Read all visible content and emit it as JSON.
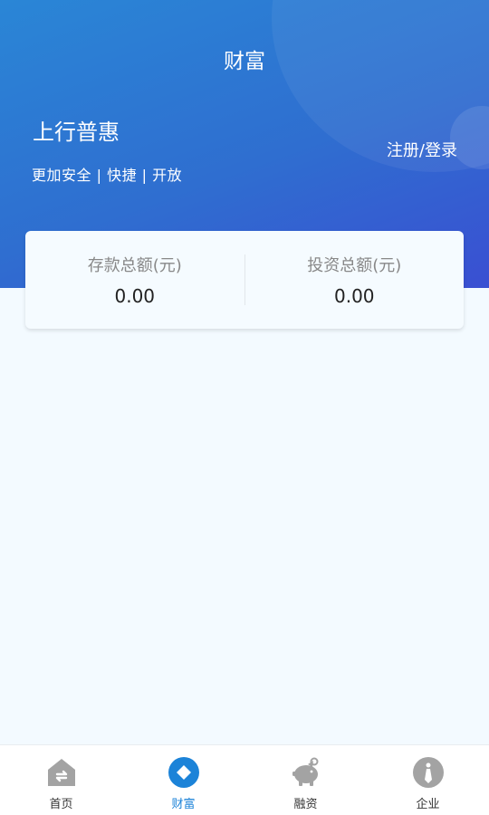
{
  "header": {
    "title": "财富",
    "brand_name": "上行普惠",
    "slogan": "更加安全 | 快捷 | 开放",
    "login_label": "注册/登录"
  },
  "summary": {
    "deposit_label": "存款总额(元)",
    "deposit_value": "0.00",
    "investment_label": "投资总额(元)",
    "investment_value": "0.00"
  },
  "tabbar": {
    "active": "财富",
    "active_color": "#1c83d8",
    "inactive_icon_color": "#a3a3a3",
    "items": [
      {
        "label": "首页",
        "icon": "home-icon"
      },
      {
        "label": "财富",
        "icon": "wealth-diamond-icon"
      },
      {
        "label": "融资",
        "icon": "piggy-bank-icon"
      },
      {
        "label": "企业",
        "icon": "enterprise-tie-icon"
      }
    ]
  },
  "colors": {
    "header_gradient_start": "#2a86d6",
    "header_gradient_end": "#3a4fd2",
    "page_background": "#f3faff"
  }
}
